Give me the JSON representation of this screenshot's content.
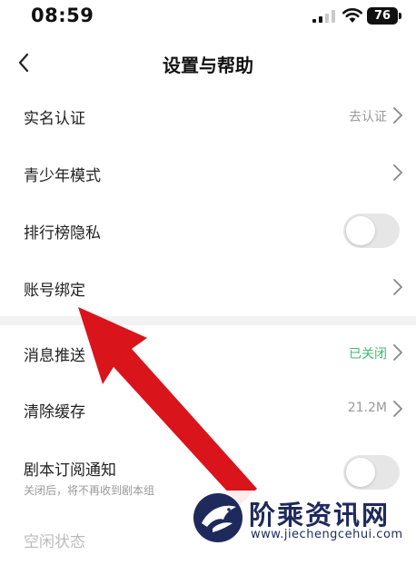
{
  "status_bar": {
    "time": "08:59",
    "battery": "76"
  },
  "nav": {
    "title": "设置与帮助"
  },
  "rows": [
    {
      "label": "实名认证",
      "value": "去认证"
    },
    {
      "label": "青少年模式"
    },
    {
      "label": "排行榜隐私",
      "toggle_on": false
    },
    {
      "label": "账号绑定"
    },
    {
      "label": "消息推送",
      "value": "已关闭"
    },
    {
      "label": "清除缓存",
      "value": "21.2M"
    },
    {
      "label": "剧本订阅通知",
      "sub": "关闭后，将不再收到剧本组",
      "toggle_on": false
    },
    {
      "label": "空闲状态"
    }
  ],
  "colors": {
    "accent_green": "#3dbb6a",
    "arrow_red": "#d9141b"
  },
  "watermark": {
    "title": "阶乘资讯网",
    "url": "www.jiechengcehui.com"
  }
}
